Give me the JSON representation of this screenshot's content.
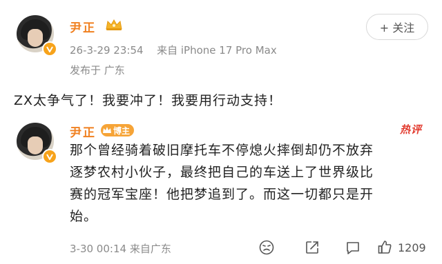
{
  "post": {
    "author_name": "尹正",
    "timestamp": "26-3-29 23:54",
    "source": "来自 iPhone 17 Pro Max",
    "location": "发布于 广东",
    "follow_label": "+ 关注",
    "text": "ZX太争气了！我要冲了！我要用行动支持！"
  },
  "comment": {
    "author_name": "尹正",
    "badge_label": "博主",
    "hot_label": "热评",
    "lines": [
      "那个曾经骑着破旧摩托车不停熄火摔倒却仍不放弃",
      "逐梦农村小伙子，最终把自己的车送上了世界级比",
      "赛的冠军宝座！他把梦追到了。而这一切都只是开",
      "始。"
    ],
    "timestamp": "3-30 00:14",
    "source": "来自广东",
    "like_count": "1209"
  },
  "icons": {
    "verified": "verified-v-icon",
    "crown": "crown-icon",
    "emoji": "emoji-icon",
    "share": "share-icon",
    "comment": "comment-icon",
    "like": "like-icon"
  },
  "colors": {
    "name": "#f08020",
    "badge": "#f6a437",
    "hot": "#e23a2e"
  }
}
